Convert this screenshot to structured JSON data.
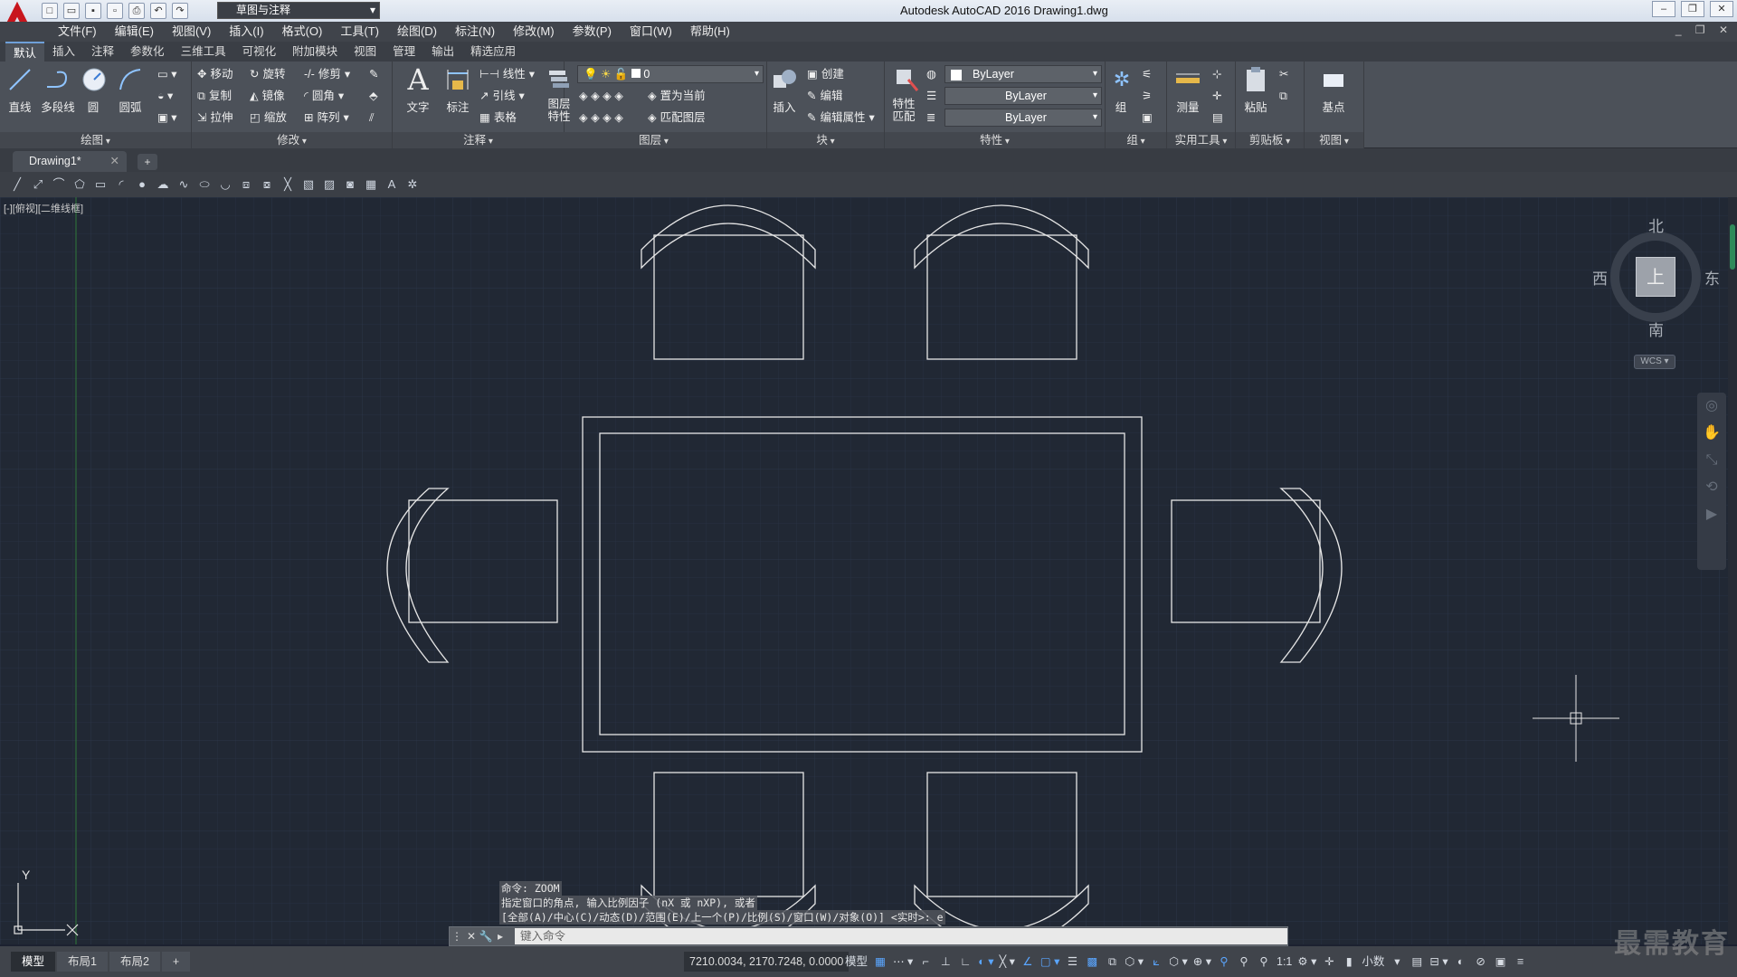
{
  "titlebar": {
    "workspace": "草图与注释",
    "title": "Autodesk AutoCAD 2016    Drawing1.dwg",
    "qat_icons": [
      "new-icon",
      "open-icon",
      "save-icon",
      "save-as-icon",
      "print-icon",
      "undo-icon",
      "redo-icon"
    ]
  },
  "menu": [
    "文件(F)",
    "编辑(E)",
    "视图(V)",
    "插入(I)",
    "格式(O)",
    "工具(T)",
    "绘图(D)",
    "标注(N)",
    "修改(M)",
    "参数(P)",
    "窗口(W)",
    "帮助(H)"
  ],
  "ribbon_tabs": [
    "默认",
    "插入",
    "注释",
    "参数化",
    "三维工具",
    "可视化",
    "附加模块",
    "视图",
    "管理",
    "输出",
    "精选应用"
  ],
  "ribbon": {
    "draw": {
      "title": "绘图",
      "line": "直线",
      "polyline": "多段线",
      "circle": "圆",
      "arc": "圆弧"
    },
    "modify": {
      "title": "修改",
      "move": "移动",
      "rotate": "旋转",
      "trim": "修剪",
      "copy": "复制",
      "mirror": "镜像",
      "fillet": "圆角",
      "stretch": "拉伸",
      "scale": "缩放",
      "array": "阵列"
    },
    "annotation": {
      "title": "注释",
      "text": "文字",
      "dim": "标注",
      "linear": "线性",
      "leader": "引线",
      "table": "表格"
    },
    "layers": {
      "title": "图层",
      "layer_props": "图层特性",
      "layer_value": "0",
      "set_current": "置为当前",
      "match_layer": "匹配图层"
    },
    "block": {
      "title": "块",
      "insert": "插入",
      "create": "创建",
      "edit": "编辑",
      "edit_attr": "编辑属性"
    },
    "properties": {
      "title": "特性",
      "match": "特性匹配",
      "color": "ByLayer",
      "linetype": "ByLayer",
      "lineweight": "ByLayer"
    },
    "group": {
      "title": "组",
      "group": "组"
    },
    "utilities": {
      "title": "实用工具",
      "measure": "测量"
    },
    "clipboard": {
      "title": "剪贴板",
      "paste": "粘贴"
    },
    "view": {
      "title": "视图",
      "base": "基点"
    }
  },
  "doc_tab": "Drawing1*",
  "viewport_label": "[-][俯视][二维线框]",
  "viewcube": {
    "top": "上",
    "north": "北",
    "south": "南",
    "east": "东",
    "west": "西",
    "wcs": "WCS"
  },
  "command": {
    "history": [
      "命令: ZOOM",
      "指定窗口的角点, 输入比例因子 (nX 或 nXP), 或者",
      "[全部(A)/中心(C)/动态(D)/范围(E)/上一个(P)/比例(S)/窗口(W)/对象(O)] <实时>: e"
    ],
    "placeholder": "键入命令"
  },
  "status": {
    "layout_tabs": [
      "模型",
      "布局1",
      "布局2"
    ],
    "coords": "7210.0034, 2170.7248, 0.0000",
    "model": "模型",
    "scale": "1:1",
    "units": "小数"
  },
  "watermark": "最需教育"
}
